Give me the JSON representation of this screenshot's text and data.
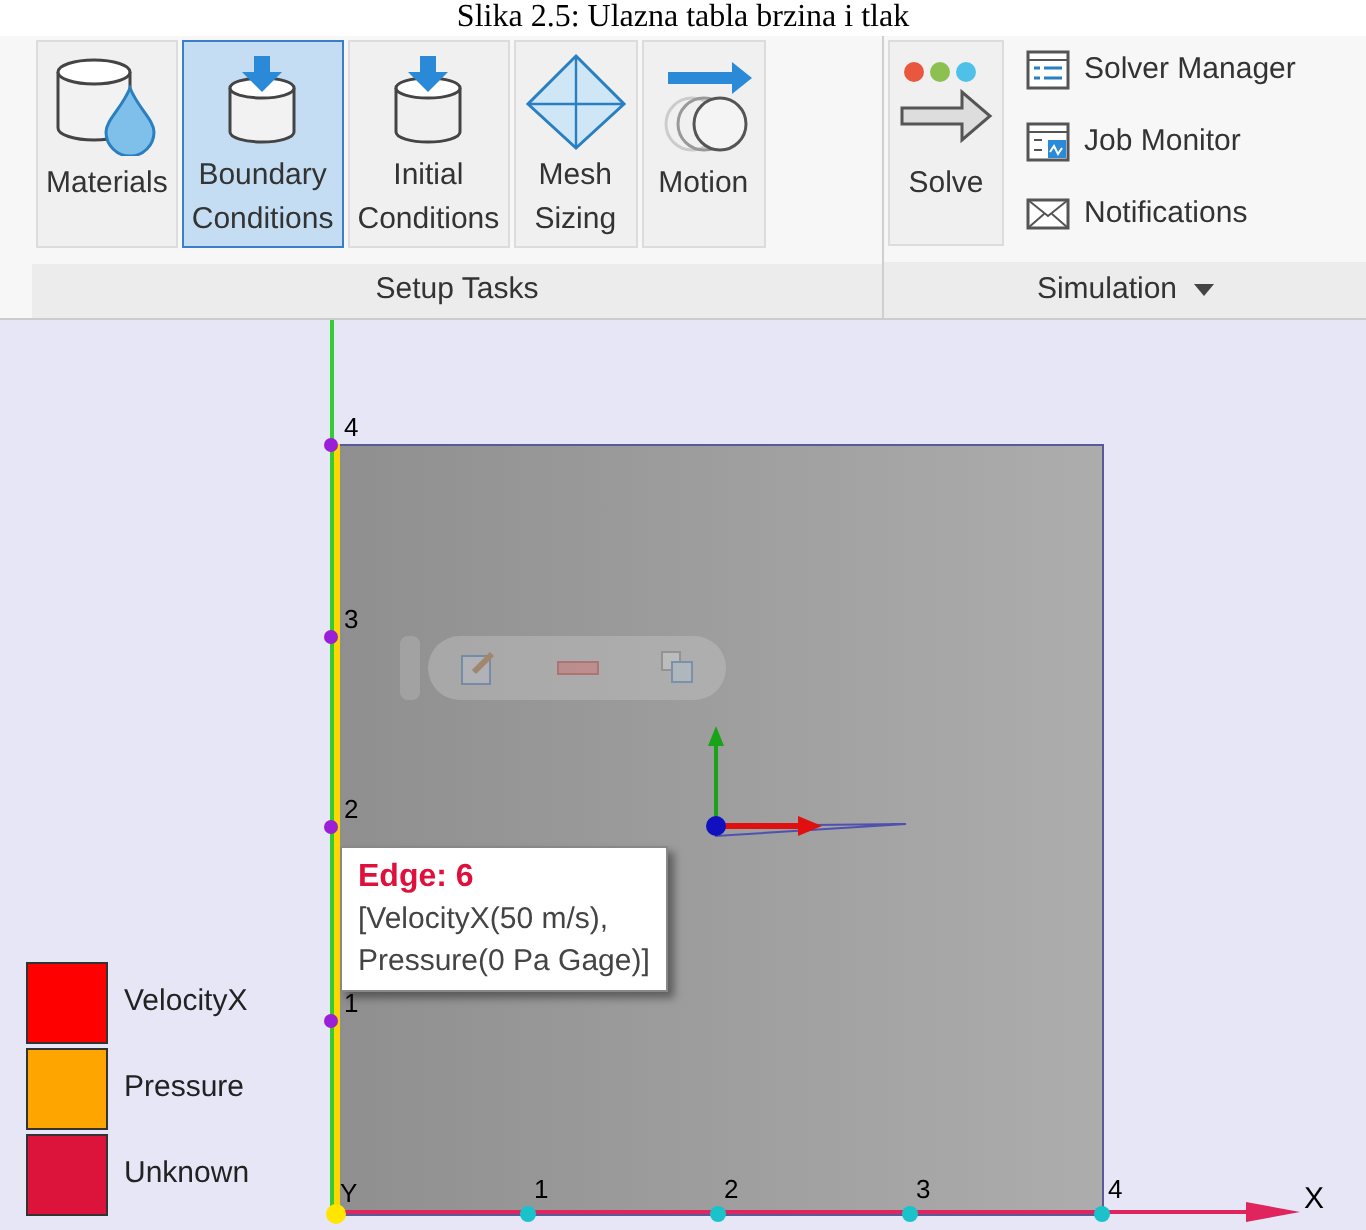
{
  "caption": "Slika 2.5: Ulazna tabla brzina i tlak",
  "ribbon": {
    "groups": [
      {
        "kind": "large",
        "label": "Setup Tasks",
        "dropdown": false,
        "buttons": [
          {
            "kind": "materials",
            "lines": [
              "Materials"
            ],
            "selected": false
          },
          {
            "kind": "boundary",
            "lines": [
              "Boundary",
              "Conditions"
            ],
            "selected": true
          },
          {
            "kind": "initial",
            "lines": [
              "Initial",
              "Conditions"
            ],
            "selected": false
          },
          {
            "kind": "mesh",
            "lines": [
              "Mesh",
              "Sizing"
            ],
            "selected": false
          },
          {
            "kind": "motion",
            "lines": [
              "Motion"
            ],
            "selected": false
          }
        ]
      },
      {
        "kind": "mixed",
        "label": "Simulation",
        "dropdown": true,
        "buttons": [
          {
            "kind": "solve",
            "lines": [
              "Solve"
            ],
            "selected": false
          }
        ],
        "items": [
          {
            "kind": "manager",
            "label": "Solver Manager"
          },
          {
            "kind": "monitor",
            "label": "Job Monitor"
          },
          {
            "kind": "mail",
            "label": "Notifications"
          }
        ]
      }
    ]
  },
  "viewport": {
    "y_axis": {
      "ticks": [
        "4",
        "3",
        "2",
        "1"
      ]
    },
    "x_axis": {
      "origin": "Y",
      "ticks": [
        "1",
        "2",
        "3",
        "4"
      ],
      "label": "X"
    },
    "tooltip": {
      "title": "Edge: 6",
      "lines": [
        "[VelocityX(50 m/s),",
        "Pressure(0 Pa Gage)]"
      ]
    },
    "legend": [
      {
        "label": "VelocityX",
        "color": "#ff0000"
      },
      {
        "label": "Pressure",
        "color": "#ffa500"
      },
      {
        "label": "Unknown",
        "color": "#dc143c"
      }
    ]
  }
}
